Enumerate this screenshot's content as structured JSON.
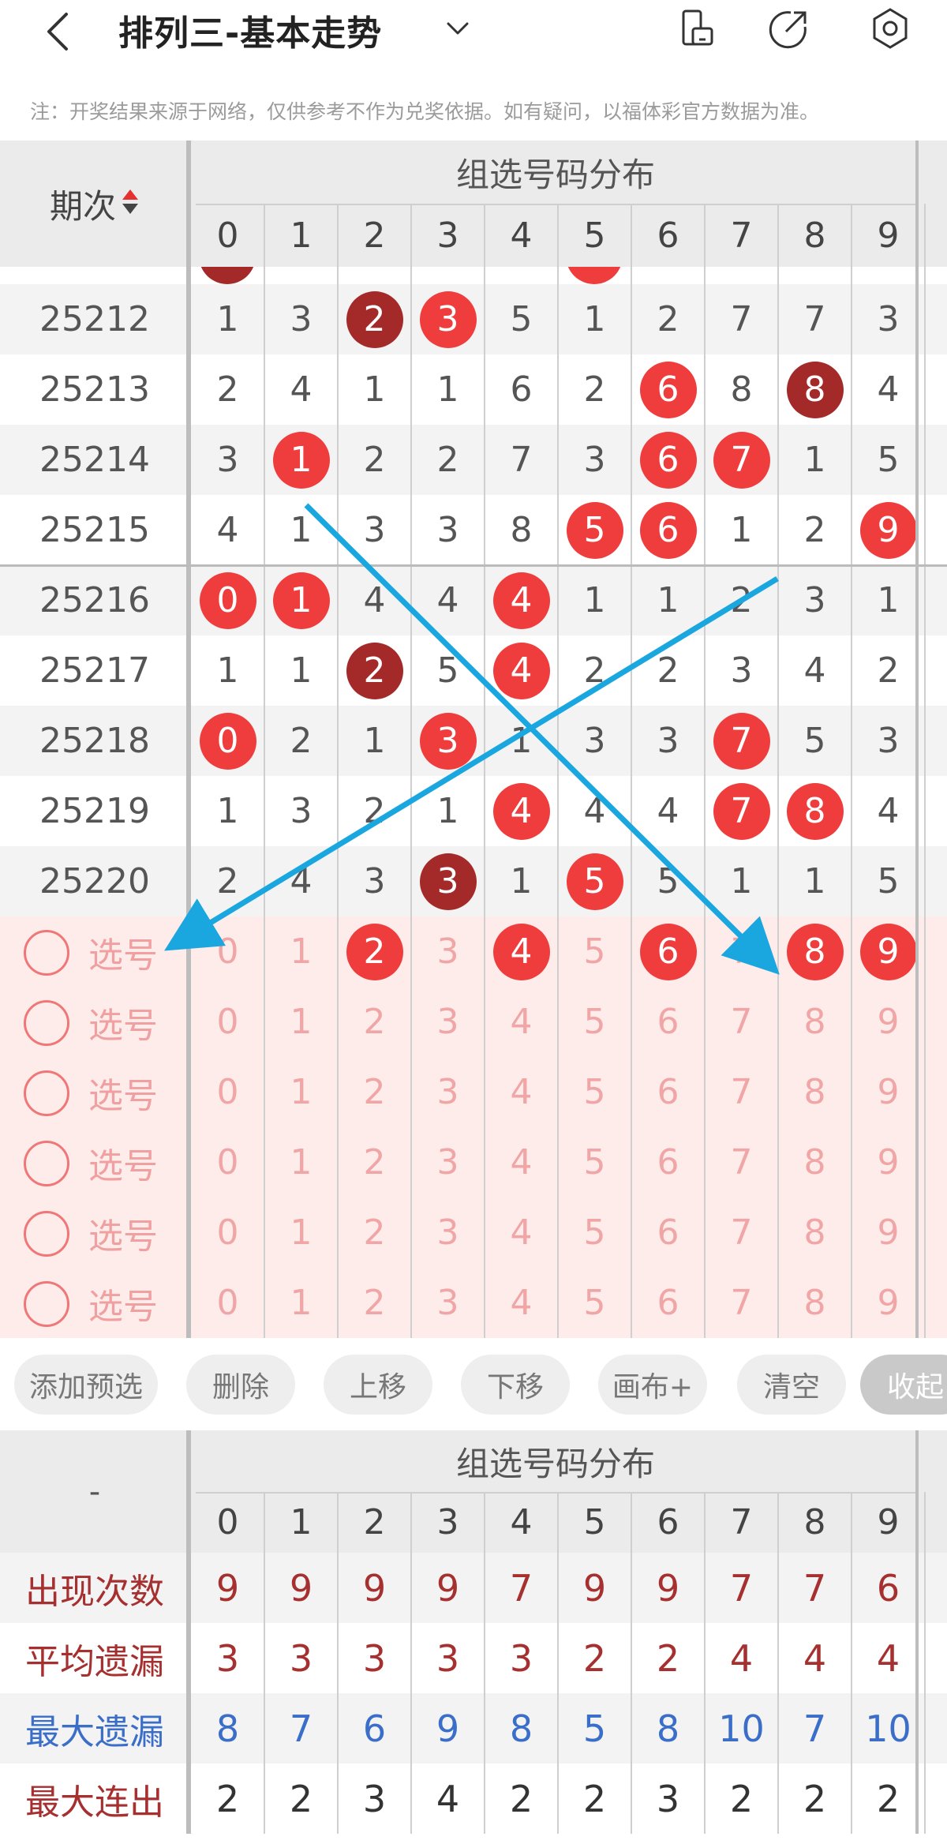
{
  "header": {
    "title": "排列三-基本走势",
    "note": "注：开奖结果来源于网络，仅供参考不作为兑奖依据。如有疑问，以福体彩官方数据为准。"
  },
  "table": {
    "issue_header": "期次",
    "group_title": "组选号码分布",
    "digits": [
      "0",
      "1",
      "2",
      "3",
      "4",
      "5",
      "6",
      "7",
      "8",
      "9"
    ],
    "rows": [
      {
        "issue": "25212",
        "cells": [
          "1",
          "3",
          "2",
          "3",
          "5",
          "1",
          "2",
          "7",
          "7",
          "3"
        ],
        "marks": {
          "2": "dark",
          "3": "red"
        }
      },
      {
        "issue": "25213",
        "cells": [
          "2",
          "4",
          "1",
          "1",
          "6",
          "2",
          "6",
          "8",
          "8",
          "4"
        ],
        "marks": {
          "6": "red",
          "8": "dark"
        }
      },
      {
        "issue": "25214",
        "cells": [
          "3",
          "1",
          "2",
          "2",
          "7",
          "3",
          "6",
          "7",
          "1",
          "5"
        ],
        "marks": {
          "1": "red",
          "6": "red",
          "7": "red"
        }
      },
      {
        "issue": "25215",
        "cells": [
          "4",
          "1",
          "3",
          "3",
          "8",
          "5",
          "6",
          "1",
          "2",
          "9"
        ],
        "marks": {
          "5": "red",
          "6": "red",
          "9": "red"
        }
      },
      {
        "issue": "25216",
        "cells": [
          "0",
          "1",
          "4",
          "4",
          "4",
          "1",
          "1",
          "2",
          "3",
          "1"
        ],
        "marks": {
          "0": "red",
          "1": "red",
          "4": "red"
        }
      },
      {
        "issue": "25217",
        "cells": [
          "1",
          "1",
          "2",
          "5",
          "4",
          "2",
          "2",
          "3",
          "4",
          "2"
        ],
        "marks": {
          "2": "dark",
          "4": "red"
        }
      },
      {
        "issue": "25218",
        "cells": [
          "0",
          "2",
          "1",
          "3",
          "1",
          "3",
          "3",
          "7",
          "5",
          "3"
        ],
        "marks": {
          "0": "red",
          "3": "red",
          "7": "red"
        }
      },
      {
        "issue": "25219",
        "cells": [
          "1",
          "3",
          "2",
          "1",
          "4",
          "4",
          "4",
          "7",
          "8",
          "4"
        ],
        "marks": {
          "4": "red",
          "7": "red",
          "8": "red"
        }
      },
      {
        "issue": "25220",
        "cells": [
          "2",
          "4",
          "3",
          "3",
          "1",
          "5",
          "5",
          "1",
          "1",
          "5"
        ],
        "marks": {
          "3": "dark",
          "5": "red"
        }
      }
    ],
    "select_label": "选号",
    "select_rows": [
      {
        "cells": [
          "0",
          "1",
          "2",
          "3",
          "4",
          "5",
          "6",
          "7",
          "8",
          "9"
        ],
        "marks": {
          "2": "red",
          "4": "red",
          "6": "red",
          "8": "red",
          "9": "red"
        }
      },
      {
        "cells": [
          "0",
          "1",
          "2",
          "3",
          "4",
          "5",
          "6",
          "7",
          "8",
          "9"
        ],
        "marks": {}
      },
      {
        "cells": [
          "0",
          "1",
          "2",
          "3",
          "4",
          "5",
          "6",
          "7",
          "8",
          "9"
        ],
        "marks": {}
      },
      {
        "cells": [
          "0",
          "1",
          "2",
          "3",
          "4",
          "5",
          "6",
          "7",
          "8",
          "9"
        ],
        "marks": {}
      },
      {
        "cells": [
          "0",
          "1",
          "2",
          "3",
          "4",
          "5",
          "6",
          "7",
          "8",
          "9"
        ],
        "marks": {}
      },
      {
        "cells": [
          "0",
          "1",
          "2",
          "3",
          "4",
          "5",
          "6",
          "7",
          "8",
          "9"
        ],
        "marks": {}
      }
    ]
  },
  "toolbar": {
    "add": "添加预选",
    "delete": "删除",
    "move_up": "上移",
    "move_down": "下移",
    "canvas": "画布+",
    "clear": "清空",
    "collapse": "收起"
  },
  "stats": {
    "corner": "-",
    "group_title": "组选号码分布",
    "digits": [
      "0",
      "1",
      "2",
      "3",
      "4",
      "5",
      "6",
      "7",
      "8",
      "9"
    ],
    "rows": [
      {
        "label": "出现次数",
        "values": [
          "9",
          "9",
          "9",
          "9",
          "7",
          "9",
          "9",
          "7",
          "7",
          "6"
        ],
        "label_color": "#a63030",
        "value_color": "#a63030"
      },
      {
        "label": "平均遗漏",
        "values": [
          "3",
          "3",
          "3",
          "3",
          "3",
          "2",
          "2",
          "4",
          "4",
          "4"
        ],
        "label_color": "#a63030",
        "value_color": "#a63030"
      },
      {
        "label": "最大遗漏",
        "values": [
          "8",
          "7",
          "6",
          "9",
          "8",
          "5",
          "8",
          "10",
          "7",
          "10"
        ],
        "label_color": "#3a6ec8",
        "value_color": "#3a6ec8"
      },
      {
        "label": "最大连出",
        "values": [
          "2",
          "2",
          "3",
          "4",
          "2",
          "2",
          "3",
          "2",
          "2",
          "2"
        ],
        "label_color": "#a63030",
        "value_color": "#333333"
      }
    ]
  },
  "colors": {
    "ball_red": "#ef3d3d",
    "ball_dark": "#a42a2a",
    "arrow": "#1aa7e0",
    "select_bg": "#fdecea"
  },
  "icons": [
    "back-chevron-icon",
    "dropdown-chevron-icon",
    "phone-switch-icon",
    "share-arrow-icon",
    "settings-gear-icon",
    "sort-arrows-icon"
  ]
}
